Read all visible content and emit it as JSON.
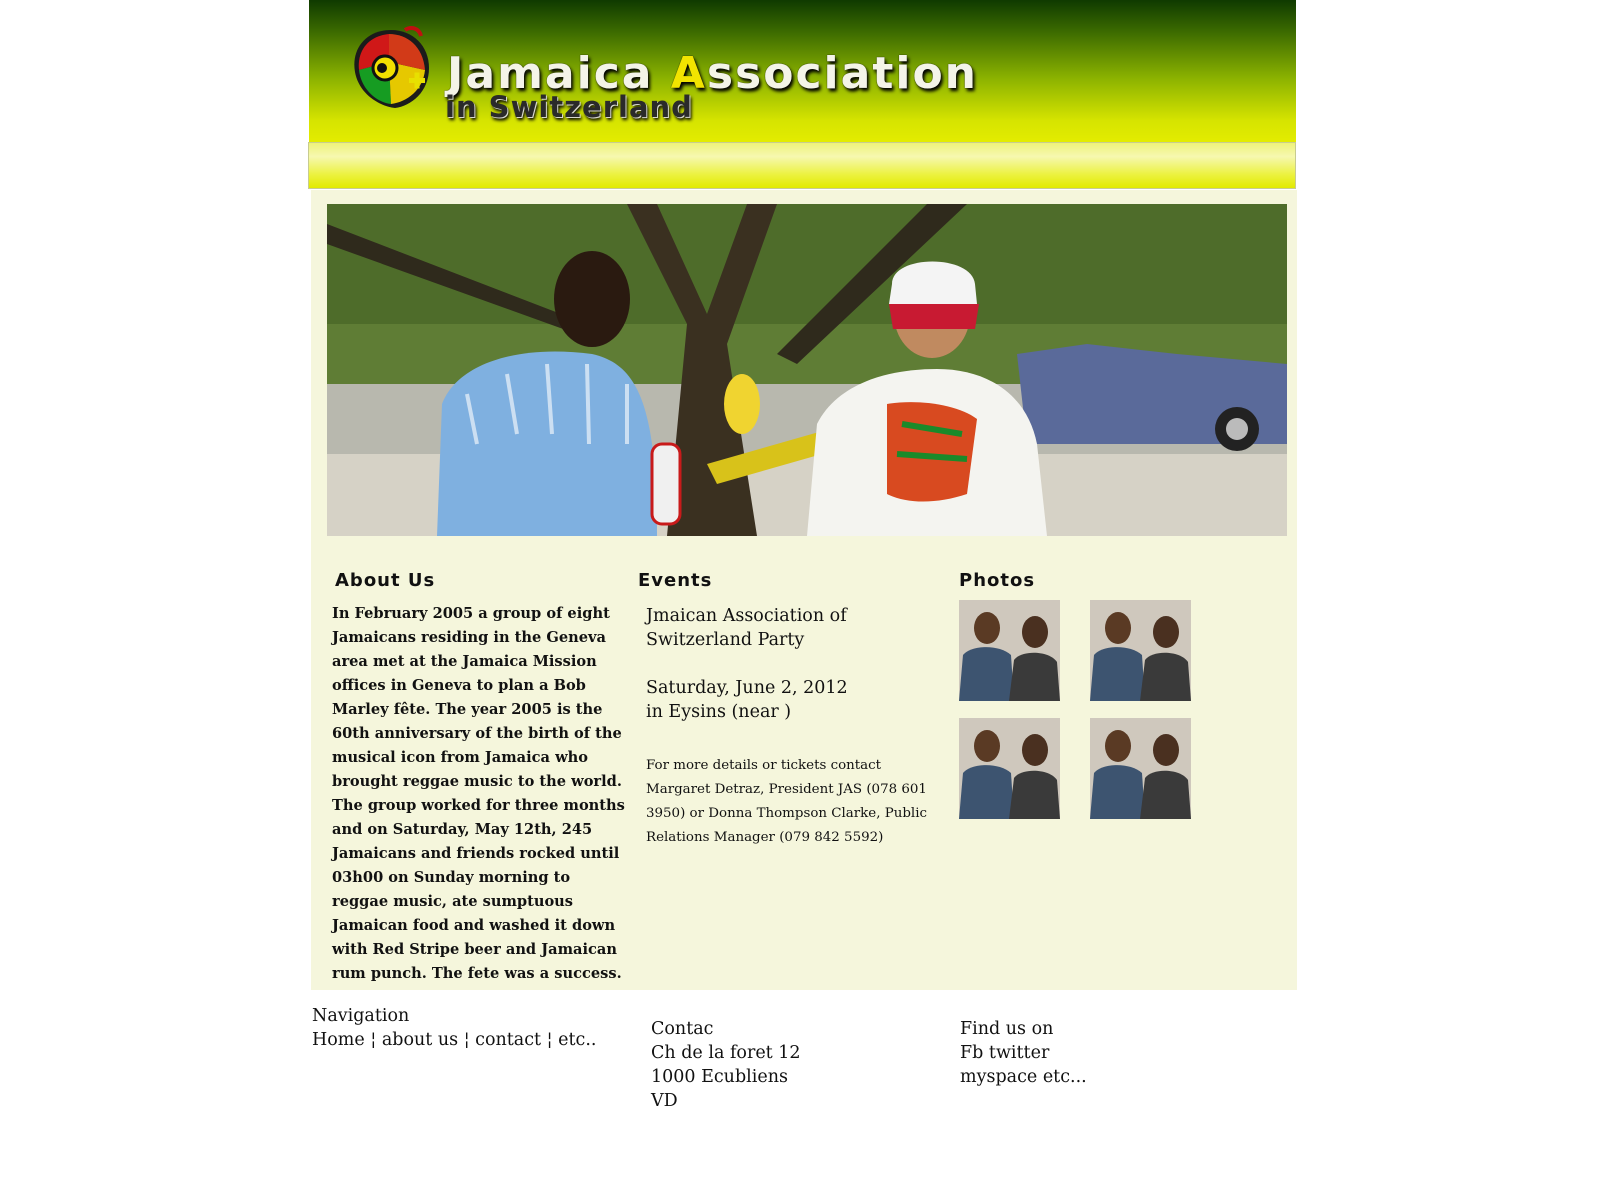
{
  "header": {
    "logo_word_1_first": "J",
    "logo_word_1_rest": "amaica",
    "logo_word_2_first": "A",
    "logo_word_2_rest": "ssociation",
    "logo_subtitle": "in Switzerland"
  },
  "colors": {
    "header_dark_green": "#0f3a00",
    "header_yellow": "#e3ec00",
    "panel_background": "#f5f6dc",
    "logo_accent_yellow": "#f2e400"
  },
  "about": {
    "title": "About Us",
    "text": "In February 2005 a group of eight Jamaicans residing in the Geneva area met at the Jamaica Mission offices in Geneva to plan a Bob Marley fête. The year 2005 is the 60th anniversary of the birth of the musical icon from Jamaica who brought reggae music to the world. The group worked for three months and on Saturday, May 12th, 245 Jamaicans and friends rocked until 03h00 on Sunday morning to reggae music, ate sumptuous Jamaican food and washed it down with Red Stripe beer and Jamaican rum punch. The fete was a success."
  },
  "events": {
    "title": "Events",
    "name": "Jmaican Association of Switzerland Party",
    "date_line": "Saturday, June 2, 2012",
    "location_line": "in Eysins (near )",
    "contact": "For more details or tickets contact Margaret Detraz, President JAS (078 601 3950) or Donna Thompson Clarke, Public Relations Manager (079 842 5592)"
  },
  "photos": {
    "title": "Photos",
    "thumbnails": [
      "photo-1",
      "photo-2",
      "photo-3",
      "photo-4"
    ]
  },
  "footer": {
    "navigation": {
      "title": "Navigation",
      "links": [
        "Home",
        "about us",
        "contact",
        "etc.."
      ],
      "separator": "¦"
    },
    "contact": {
      "lines": [
        "Contac",
        "Ch de la foret 12",
        "1000 Ecubliens",
        "VD"
      ]
    },
    "social": {
      "lines": [
        "Find us on",
        "Fb twitter",
        "myspace etc..."
      ]
    }
  }
}
